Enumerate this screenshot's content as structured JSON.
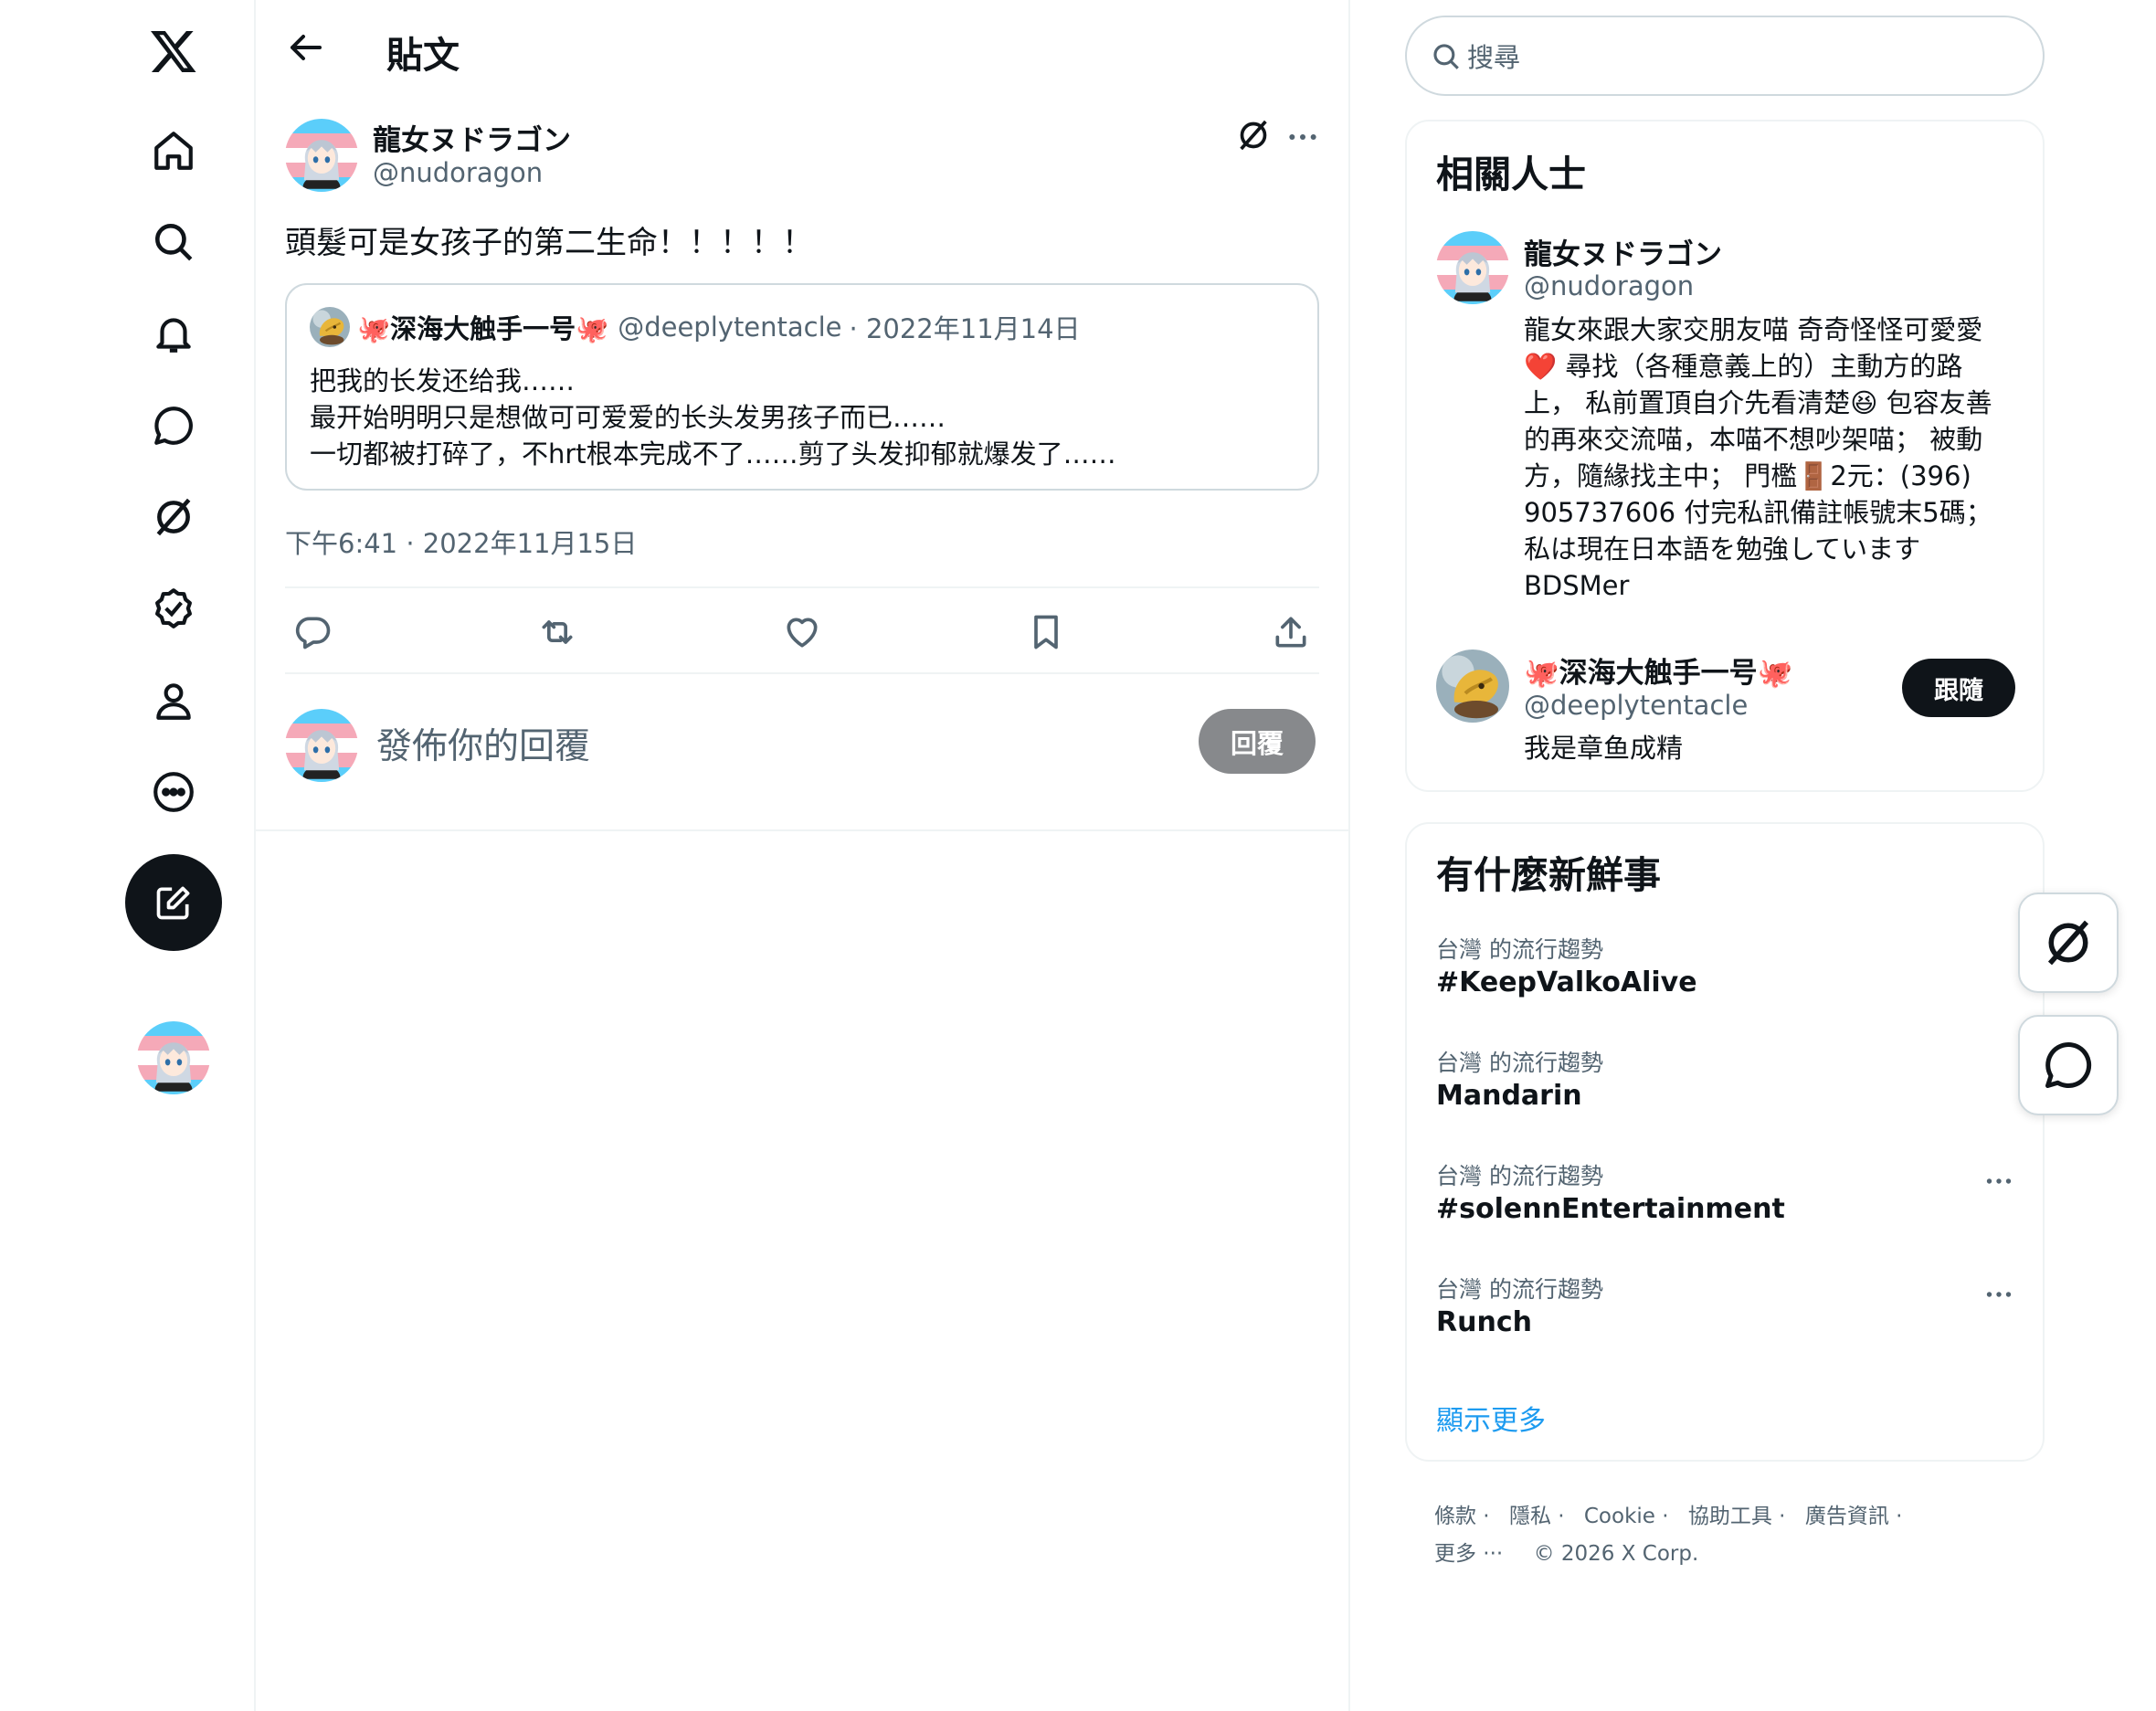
{
  "header": {
    "title": "貼文"
  },
  "post": {
    "author_name": "龍女ヌドラゴン",
    "author_handle": "@nudoragon",
    "text": "頭髮可是女孩子的第二生命！！！！！",
    "timestamp": "下午6:41 · 2022年11月15日",
    "quote": {
      "name": "🐙深海大触手一号🐙",
      "handle": "@deeplytentacle",
      "date": "· 2022年11月14日",
      "lines": [
        "把我的长发还给我……",
        "最开始明明只是想做可可爱爱的长头发男孩子而已……",
        "一切都被打碎了，不hrt根本完成不了……剪了头发抑郁就爆发了……"
      ]
    }
  },
  "reply": {
    "placeholder": "發佈你的回覆",
    "button_label": "回覆"
  },
  "search": {
    "placeholder": "搜尋"
  },
  "related": {
    "title": "相關人士",
    "people": [
      {
        "name": "龍女ヌドラゴン",
        "handle": "@nudoragon",
        "bio_lines": [
          "龍女來跟大家交朋友喵 奇奇怪怪可愛愛",
          "❤️ 尋找（各種意義上的）主動方的路",
          "上， 私前置頂自介先看清楚😆 包容友善",
          "的再來交流喵，本喵不想吵架喵； 被動",
          "方，隨緣找主中； 門檻🚪2元：(396)",
          "905737606 付完私訊備註帳號末5碼；",
          "私は現在日本語を勉強しています",
          "BDSMer"
        ]
      },
      {
        "name": "🐙深海大触手一号🐙",
        "handle": "@deeplytentacle",
        "bio": "我是章鱼成精",
        "follow_label": "跟隨"
      }
    ]
  },
  "trends": {
    "title": "有什麼新鮮事",
    "items": [
      {
        "category": "台灣 的流行趨勢",
        "name": "#KeepValkoAlive"
      },
      {
        "category": "台灣 的流行趨勢",
        "name": "Mandarin"
      },
      {
        "category": "台灣 的流行趨勢",
        "name": "#solennEntertainment"
      },
      {
        "category": "台灣 的流行趨勢",
        "name": "Runch"
      }
    ],
    "show_more": "顯示更多"
  },
  "footer": {
    "row1": [
      "條款 ·",
      "隱私 ·",
      "Cookie ·",
      "協助工具 ·",
      "廣告資訊 ·"
    ],
    "more": "更多 ···",
    "copyright": "© 2026 X Corp."
  },
  "colors": {
    "accent": "#1d9bf0",
    "text": "#0f1419",
    "secondary": "#536471",
    "border": "#eff3f4",
    "button_dark": "#0f1419"
  }
}
